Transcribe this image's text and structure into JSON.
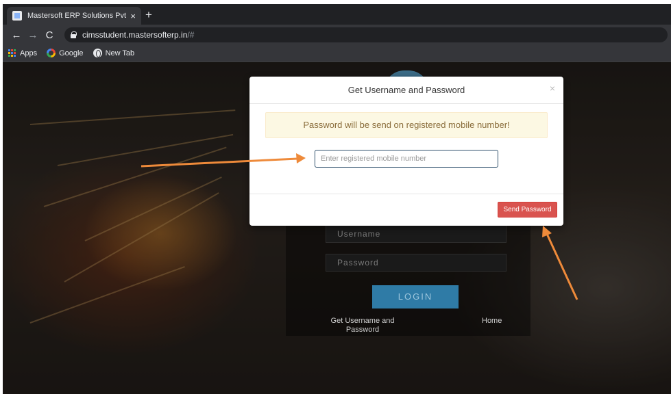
{
  "browser": {
    "tab_title": "Mastersoft ERP Solutions Pvt.Ltd",
    "tab_close": "×",
    "new_tab": "+",
    "nav": {
      "back": "←",
      "forward": "→",
      "reload": "C"
    },
    "url_host": "cimsstudent.mastersofterp.in",
    "url_path": "/#",
    "bookmarks": [
      "Apps",
      "Google",
      "New Tab"
    ]
  },
  "login": {
    "username_placeholder": "Username",
    "password_placeholder": "Password",
    "login_button": "LOGIN",
    "get_credentials_link": "Get Username and Password",
    "home_link": "Home"
  },
  "modal": {
    "title": "Get Username and Password",
    "close": "×",
    "alert": "Password will be send on registered mobile number!",
    "mobile_placeholder": "Enter registered mobile number",
    "send_button": "Send Password"
  },
  "colors": {
    "send_button": "#d9534f",
    "alert_bg": "#fcf8e3",
    "annotation_arrow": "#ee8a3a"
  }
}
